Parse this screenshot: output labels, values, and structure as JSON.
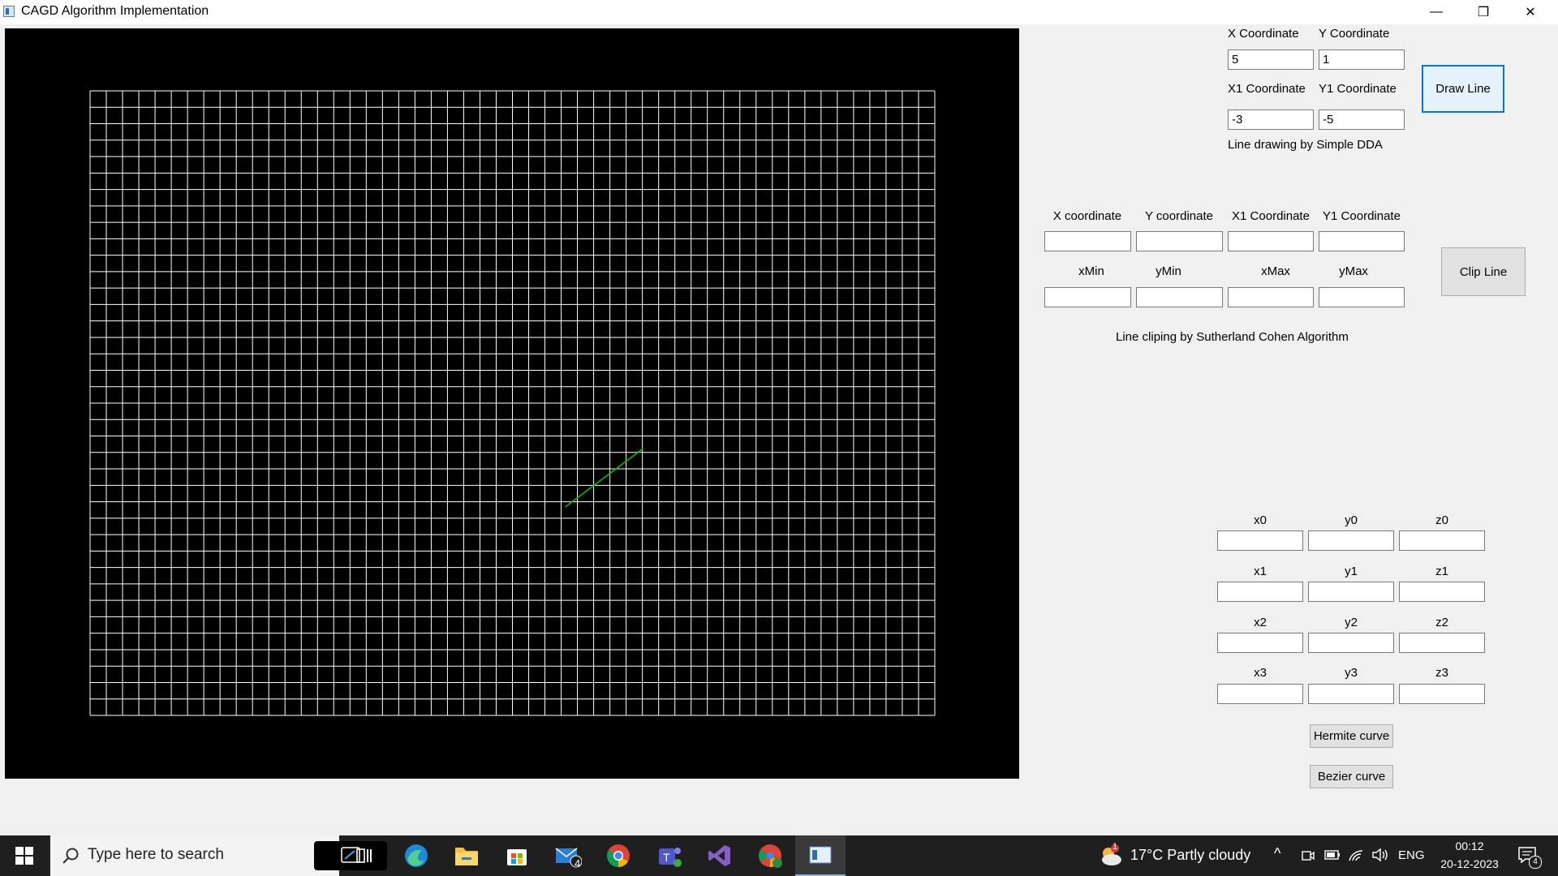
{
  "window": {
    "title": "CAGD Algorithm Implementation",
    "minimize": "—",
    "maximize": "❐",
    "close": "✕"
  },
  "colors": {
    "canvas_bg": "#000000",
    "grid": "#ffffff",
    "line": "#00c000",
    "accent": "#0078d7"
  },
  "dda": {
    "x_label": "X Coordinate",
    "y_label": "Y Coordinate",
    "x_value": "5",
    "y_value": "1",
    "x1_label": "X1 Coordinate",
    "y1_label": "Y1 Coordinate",
    "x1_value": "-3",
    "y1_value": "-5",
    "button": "Draw Line",
    "caption": "Line drawing by Simple DDA"
  },
  "clip": {
    "x_label": "X coordinate",
    "y_label": "Y coordinate",
    "x1_label": "X1 Coordinate",
    "y1_label": "Y1 Coordinate",
    "xmin_label": "xMin",
    "ymin_label": "yMin",
    "xmax_label": "xMax",
    "ymax_label": "yMax",
    "x_value": "",
    "y_value": "",
    "x1_value": "",
    "y1_value": "",
    "xmin_value": "",
    "ymin_value": "",
    "xmax_value": "",
    "ymax_value": "",
    "button": "Clip Line",
    "caption": "Line cliping by Sutherland Cohen Algorithm"
  },
  "curve": {
    "labels": [
      [
        "x0",
        "y0",
        "z0"
      ],
      [
        "x1",
        "y1",
        "z1"
      ],
      [
        "x2",
        "y2",
        "z2"
      ],
      [
        "x3",
        "y3",
        "z3"
      ]
    ],
    "values": [
      [
        "",
        "",
        ""
      ],
      [
        "",
        "",
        ""
      ],
      [
        "",
        "",
        ""
      ],
      [
        "",
        "",
        ""
      ]
    ],
    "hermite_button": "Hermite curve",
    "bezier_button": "Bezier curve"
  },
  "grid": {
    "columns": 52,
    "rows": 38
  },
  "drawn_line": {
    "start": [
      -3,
      -5
    ],
    "end": [
      5,
      1
    ]
  },
  "taskbar": {
    "search_placeholder": "Type here to search",
    "icons": [
      "windows-start-icon",
      "search-icon",
      "task-view-icon",
      "edge-icon",
      "file-explorer-icon",
      "microsoft-store-icon",
      "mail-icon",
      "chrome-icon",
      "teams-icon",
      "visual-studio-icon",
      "chrome-profile-icon",
      "app-window-icon"
    ],
    "mail_badge": "4",
    "weather_badge": "1",
    "weather": "17°C  Partly cloudy",
    "language": "ENG",
    "time": "00:12",
    "date": "20-12-2023",
    "notification_badge": "4"
  }
}
